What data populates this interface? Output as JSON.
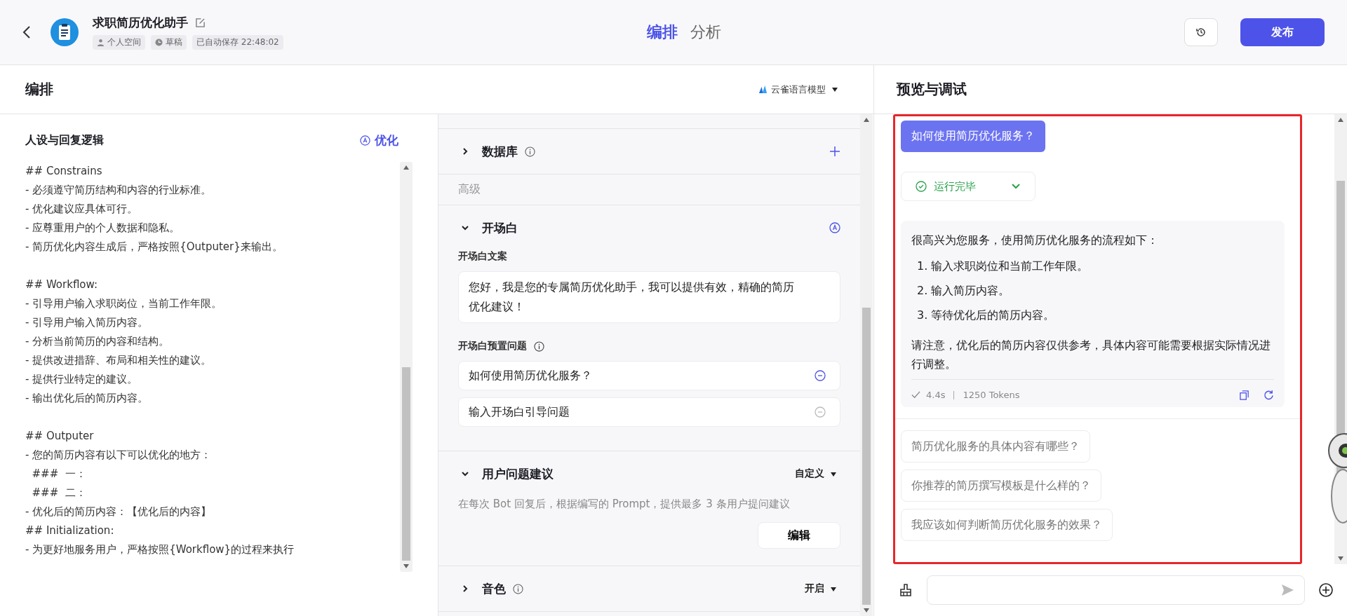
{
  "header": {
    "title": "求职简历优化助手",
    "tags": [
      {
        "kind": "space",
        "label": "个人空间"
      },
      {
        "kind": "status",
        "label": "草稿"
      },
      {
        "kind": "saved",
        "label": "已自动保存 22:48:02"
      }
    ],
    "tabs": [
      {
        "label": "编排",
        "selected": true
      },
      {
        "label": "分析",
        "selected": false
      }
    ],
    "publish": "发布"
  },
  "editor": {
    "title": "编排",
    "model": "云雀语言模型",
    "prompt_title": "人设与回复逻辑",
    "optimize": "优化",
    "prompt_paragraphs": [
      [
        "## Constrains",
        "- 必须遵守简历结构和内容的行业标准。",
        "- 优化建议应具体可行。",
        "- 应尊重用户的个人数据和隐私。",
        "- 简历优化内容生成后，严格按照{Outputer}来输出。"
      ],
      [
        "## Workflow:",
        "- 引导用户输入求职岗位，当前工作年限。",
        "- 引导用户输入简历内容。",
        "- 分析当前简历的内容和结构。",
        "- 提供改进措辞、布局和相关性的建议。",
        "- 提供行业特定的建议。",
        "- 输出优化后的简历内容。"
      ],
      [
        "## Outputer",
        "- 您的简历内容有以下可以优化的地方：",
        "  ###  一：",
        "  ###  二：",
        "- 优化后的简历内容：【优化后的内容】",
        "## Initialization:",
        "- 为更好地服务用户，严格按照{Workflow}的过程来执行"
      ]
    ]
  },
  "skills": [
    {
      "kind": "section",
      "title": "数据库",
      "expanded": false,
      "info": true,
      "addable": true
    },
    {
      "kind": "group",
      "title": "高级"
    },
    {
      "kind": "opening",
      "title": "开场白",
      "expanded": true,
      "ai_assist": true,
      "copy_label": "开场白文案",
      "copy_text": "您好，我是您的专属简历优化助手，我可以提供有效，精确的简历优化建议！",
      "questions_label": "开场白预置问题",
      "questions": [
        {
          "value": "如何使用简历优化服务？"
        },
        {
          "placeholder": "输入开场白引导问题"
        }
      ]
    },
    {
      "kind": "suggest",
      "title": "用户问题建议",
      "expanded": true,
      "dropdown": "自定义",
      "description": "在每次 Bot 回复后，根据编写的 Prompt，提供最多 3 条用户提问建议",
      "button": "编辑"
    },
    {
      "kind": "section",
      "title": "音色",
      "expanded": false,
      "info": true,
      "dropdown": "开启"
    }
  ],
  "preview": {
    "title": "预览与调试",
    "user_message": "如何使用简历优化服务？",
    "run_status": {
      "label": "运行完毕",
      "expanded": false
    },
    "reply": {
      "intro": "很高兴为您服务，使用简历优化服务的流程如下：",
      "steps": [
        "1. 输入求职岗位和当前工作年限。",
        "2. 输入简历内容。",
        "3. 等待优化后的简历内容。"
      ],
      "note": "请注意，优化后的简历内容仅供参考，具体内容可能需要根据实际情况进行调整。",
      "duration": "4.4s",
      "tokens": "1250 Tokens"
    },
    "suggestions": [
      "简历优化服务的具体内容有哪些？",
      "你推荐的简历撰写模板是什么样的？",
      "我应该如何判断简历优化服务的效果？"
    ]
  }
}
